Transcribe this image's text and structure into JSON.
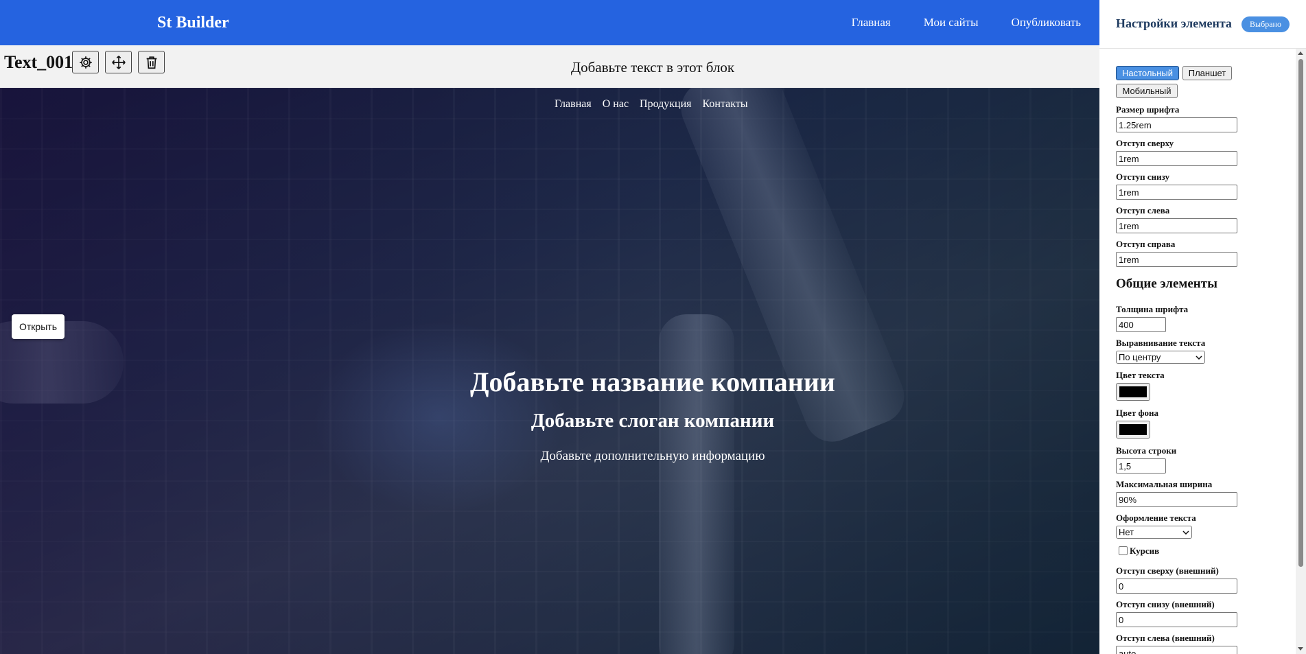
{
  "header": {
    "brand": "St Builder",
    "nav": [
      "Главная",
      "Мои сайты",
      "Опубликовать"
    ]
  },
  "text_block": {
    "element_id": "Text_001",
    "content": "Добавьте текст в этот блок",
    "tools": [
      "gear-icon",
      "move-icon",
      "trash-icon"
    ]
  },
  "hero": {
    "nav": [
      "Главная",
      "О нас",
      "Продукция",
      "Контакты"
    ],
    "title": "Добавьте название компании",
    "slogan": "Добавьте слоган компании",
    "info": "Добавьте дополнительную информацию",
    "open_button": "Открыть"
  },
  "panel": {
    "title": "Настройки элемента",
    "badge": "Выбрано",
    "devices": {
      "desktop": "Настольный",
      "tablet": "Планшет",
      "mobile": "Мобильный",
      "active": "desktop"
    },
    "responsive": [
      {
        "label": "Размер шрифта",
        "value": "1.25rem"
      },
      {
        "label": "Отступ сверху",
        "value": "1rem"
      },
      {
        "label": "Отступ снизу",
        "value": "1rem"
      },
      {
        "label": "Отступ слева",
        "value": "1rem"
      },
      {
        "label": "Отступ справа",
        "value": "1rem"
      }
    ],
    "common_title": "Общие элементы",
    "font_weight": {
      "label": "Толщина шрифта",
      "value": "400"
    },
    "text_align": {
      "label": "Выравнивание текста",
      "value": "По центру"
    },
    "text_color": {
      "label": "Цвет текста",
      "value": "#000000"
    },
    "bg_color": {
      "label": "Цвет фона",
      "value": "#000000"
    },
    "line_height": {
      "label": "Высота строки",
      "value": "1,5"
    },
    "max_width": {
      "label": "Максимальная ширина",
      "value": "90%"
    },
    "decoration": {
      "label": "Оформление текста",
      "value": "Нет"
    },
    "italic": {
      "label": "Курсив",
      "checked": false
    },
    "margin_top": {
      "label": "Отступ сверху (внешний)",
      "value": "0"
    },
    "margin_bottom": {
      "label": "Отступ снизу (внешний)",
      "value": "0"
    },
    "margin_left": {
      "label": "Отступ слева (внешний)",
      "value": "auto"
    }
  },
  "colors": {
    "header": "#2563e0",
    "accent": "#4a90e2"
  }
}
